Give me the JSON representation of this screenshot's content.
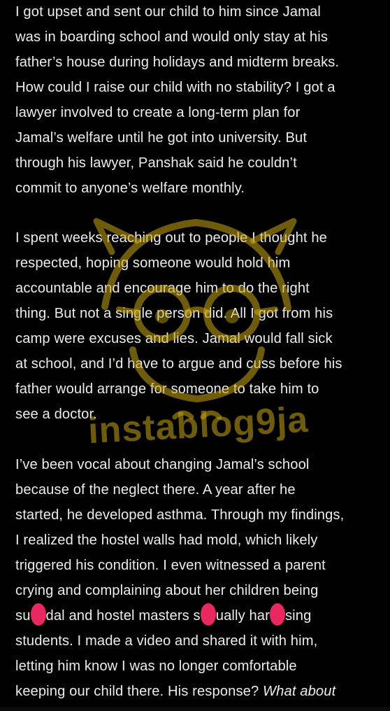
{
  "paragraphs": [
    {
      "lines": [
        "I got upset and sent our child to him since Jamal",
        "was in boarding school and would only stay at his",
        "father’s house during holidays and midterm breaks.",
        "How could I raise our child with no stability? I got a",
        "lawyer involved to create a long-term plan for",
        "Jamal’s welfare until he got into university. But",
        "through his lawyer, Panshak said he couldn’t",
        "commit to anyone’s welfare monthly."
      ]
    },
    {
      "lines": [
        "I spent weeks reaching out to people I thought he",
        "respected, hoping someone would hold him",
        "accountable and encourage him to do the right",
        "thing. But not a single person did. All I got from his",
        "camp were excuses and lies. Jamal would fall sick",
        "at school, and I’d have to argue and cuss before his",
        "father would arrange for someone to take him to",
        "see a doctor."
      ]
    },
    {
      "lines": [
        "I’ve been vocal about changing Jamal’s school",
        "because of the neglect there. A year after he",
        "started, he developed asthma. Through my findings,",
        "I realized the hostel walls had mold, which likely",
        "triggered his condition. I even witnessed a parent",
        "crying and complaining about her children being"
      ],
      "censored_line": {
        "seg1": "su",
        "seg2": "dal and hostel masters s",
        "seg3": "ually har",
        "seg4": "sing"
      },
      "lines_after": [
        "students. I made a video and shared it with him,",
        "letting him know I was no longer comfortable"
      ],
      "last_line": {
        "normal": "keeping our child there. His response? ",
        "italic": "What about"
      }
    }
  ],
  "watermark": {
    "text": "instablog9ja",
    "color": "#c8a814"
  },
  "colors": {
    "background": "#000000",
    "text": "#ececec",
    "censor_blot": "#e8285f"
  }
}
